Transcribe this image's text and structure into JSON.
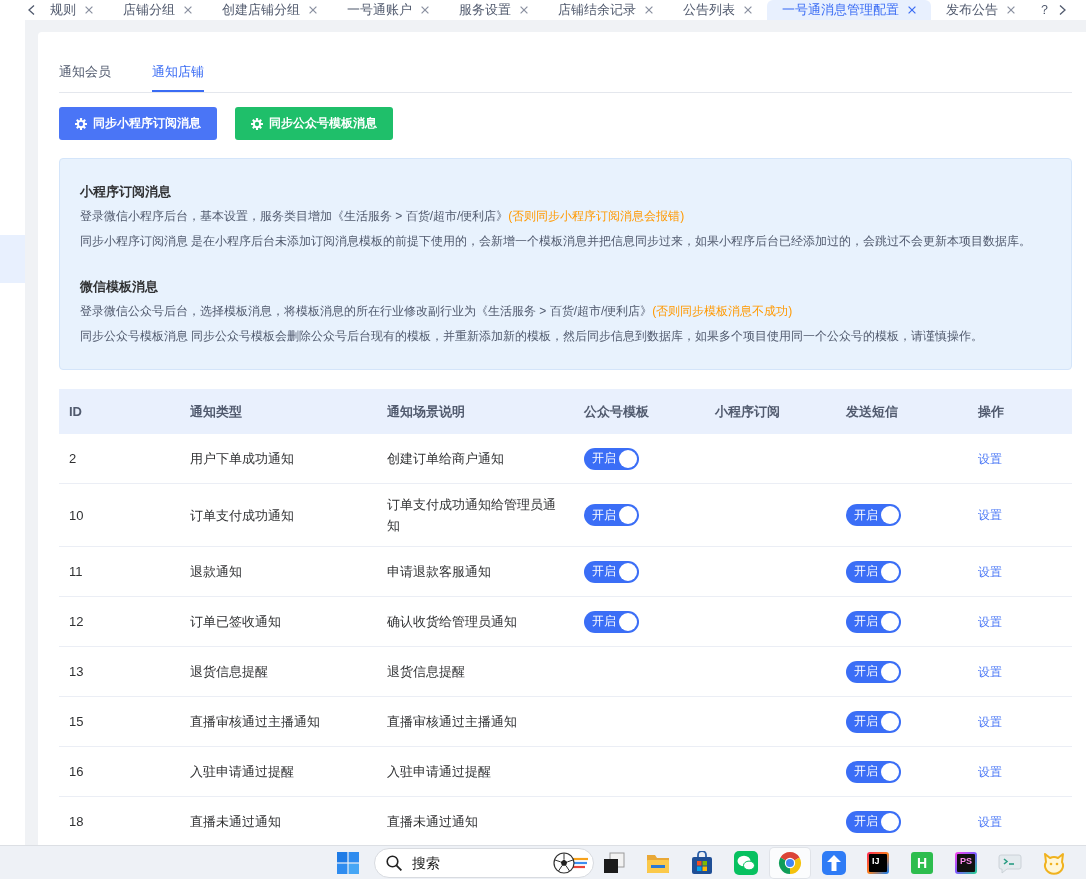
{
  "tab_bar": {
    "tabs": [
      {
        "label": "规则",
        "selected": false
      },
      {
        "label": "店铺分组",
        "selected": false
      },
      {
        "label": "创建店铺分组",
        "selected": false
      },
      {
        "label": "一号通账户",
        "selected": false
      },
      {
        "label": "服务设置",
        "selected": false
      },
      {
        "label": "店铺结余记录",
        "selected": false
      },
      {
        "label": "公告列表",
        "selected": false
      },
      {
        "label": "一号通消息管理配置",
        "selected": true
      },
      {
        "label": "发布公告",
        "selected": false
      }
    ],
    "overflow_tab": "？"
  },
  "notify_tabs": [
    {
      "label": "通知会员",
      "selected": false
    },
    {
      "label": "通知店铺",
      "selected": true
    }
  ],
  "sync_buttons": [
    {
      "label": "同步小程序订阅消息",
      "kind": "primary"
    },
    {
      "label": "同步公众号模板消息",
      "kind": "success"
    }
  ],
  "notice": [
    {
      "title": "小程序订阅消息",
      "lines": [
        {
          "text": "登录微信小程序后台，基本设置，服务类目增加《生活服务 > 百货/超市/便利店》",
          "warning": "(否则同步小程序订阅消息会报错)"
        },
        {
          "text": "同步小程序订阅消息 是在小程序后台未添加订阅消息模板的前提下使用的，会新增一个模板消息并把信息同步过来，如果小程序后台已经添加过的，会跳过不会更新本项目数据库。"
        }
      ]
    },
    {
      "title": "微信模板消息",
      "lines": [
        {
          "text": "登录微信公众号后台，选择模板消息，将模板消息的所在行业修改副行业为《生活服务 > 百货/超市/便利店》",
          "warning": "(否则同步模板消息不成功)"
        },
        {
          "text": "同步公众号模板消息 同步公众号模板会删除公众号后台现有的模板，并重新添加新的模板，然后同步信息到数据库，如果多个项目使用同一个公众号的模板，请谨慎操作。"
        }
      ]
    }
  ],
  "table": {
    "columns": [
      "ID",
      "通知类型",
      "通知场景说明",
      "公众号模板",
      "小程序订阅",
      "发送短信",
      "操作"
    ],
    "rows": [
      {
        "id": "2",
        "type": "用户下单成功通知",
        "scene": "创建订单给商户通知",
        "official_account": {
          "label": "开启",
          "on": true
        },
        "action": "设置"
      },
      {
        "id": "10",
        "type": "订单支付成功通知",
        "scene": "订单支付成功通知给管理员通知",
        "official_account": {
          "label": "开启",
          "on": true
        },
        "sms": {
          "label": "开启",
          "on": true
        },
        "action": "设置"
      },
      {
        "id": "11",
        "type": "退款通知",
        "scene": "申请退款客服通知",
        "official_account": {
          "label": "开启",
          "on": true
        },
        "sms": {
          "label": "开启",
          "on": true
        },
        "action": "设置"
      },
      {
        "id": "12",
        "type": "订单已签收通知",
        "scene": "确认收货给管理员通知",
        "official_account": {
          "label": "开启",
          "on": true
        },
        "sms": {
          "label": "开启",
          "on": true
        },
        "action": "设置"
      },
      {
        "id": "13",
        "type": "退货信息提醒",
        "scene": "退货信息提醒",
        "sms": {
          "label": "开启",
          "on": true
        },
        "action": "设置"
      },
      {
        "id": "15",
        "type": "直播审核通过主播通知",
        "scene": "直播审核通过主播通知",
        "sms": {
          "label": "开启",
          "on": true
        },
        "action": "设置"
      },
      {
        "id": "16",
        "type": "入驻申请通过提醒",
        "scene": "入驻申请通过提醒",
        "sms": {
          "label": "开启",
          "on": true
        },
        "action": "设置"
      },
      {
        "id": "18",
        "type": "直播未通过通知",
        "scene": "直播未通过通知",
        "sms": {
          "label": "开启",
          "on": true
        },
        "action": "设置"
      }
    ]
  },
  "taskbar": {
    "search": {
      "placeholder": "搜索"
    },
    "apps": [
      {
        "kind": "squares",
        "active": false
      },
      {
        "kind": "folder",
        "active": false
      },
      {
        "kind": "store",
        "active": false
      },
      {
        "kind": "chat",
        "active": false
      },
      {
        "kind": "browser",
        "active": true
      },
      {
        "kind": "arrow",
        "active": false
      },
      {
        "kind": "darktile",
        "glyph": "IJ",
        "active": false
      },
      {
        "kind": "greentile",
        "glyph": "H",
        "active": false
      },
      {
        "kind": "purpletile",
        "glyph": "PS",
        "active": false
      },
      {
        "kind": "terminal",
        "active": false
      },
      {
        "kind": "cat",
        "active": false
      }
    ]
  }
}
